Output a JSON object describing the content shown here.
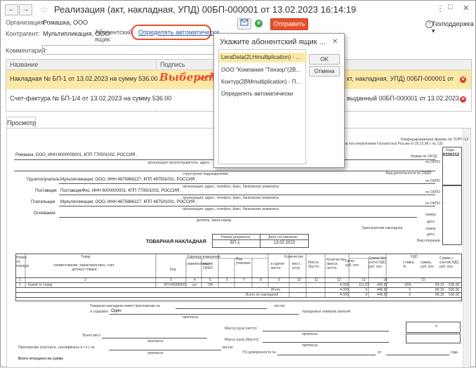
{
  "window": {
    "title": "Реализация (акт, накладная, УПД) 00БП-000001 от 13.02.2023 16:14:19",
    "nav_back": "←",
    "nav_forward": "→",
    "star": "☆",
    "more": "⋮",
    "restore": "□",
    "close": "✕"
  },
  "form": {
    "org_label": "Организация:",
    "org_value": "Ромашка, ООО",
    "contr_label": "Контрагент:",
    "contr_value": "Мультипликация, ООО",
    "abon_label_1": "Абонентский",
    "abon_label_2": "ящик:",
    "abon_link": "Определять автоматически",
    "comment_label": "Комментарий:",
    "send_button": "Отправить",
    "support_label": "Техподдержка",
    "support_arrow": "▾",
    "help": "?"
  },
  "table": {
    "col_name": "Название",
    "col_sign": "Подпись",
    "rows": [
      {
        "name": "Накладная № БП-1 от 13.02.2023 на сумму 536.00",
        "right": "кт, накладная, УПД) 00БП-000001 от"
      },
      {
        "name": "Счет-фактура № БП-1/4 от 13.02.2023 на сумму 536.00",
        "right": "выданный 00БП-000001 от 13.02.2023"
      }
    ],
    "annotation": "Выберите"
  },
  "tab": {
    "label": "Просмотр"
  },
  "popup": {
    "title": "Укажите абонентский ящик ...",
    "close": "✕",
    "items": [
      "LeraData(2LHmultiplication) - ...",
      "ООО \"Компания \"Тензор\"(2B...",
      "Контур(2BMmultiplication) - П...",
      "Определять автоматически"
    ],
    "ok": "OK",
    "cancel": "Отмена"
  },
  "doc": {
    "header_form": "Унифицированная форма № ТОРГ-12",
    "header_decree": "...дена постановлением Госкомстата России от 25.12.98 г. № 132",
    "codes": "Коды",
    "okud_label": "Форма по ОКУД",
    "okud": "0330212",
    "okpo": "по ОКПО",
    "supplier_org": "Ромашка, ООО, ИНН 6000000001, КПП 770501002, РОССИЯ ,",
    "org_caption": "организация-грузоотправитель, адрес,",
    "unit_caption": "структурное подразделение",
    "okdp": "Вид деятельности по ОКДП",
    "consignee_label": "Грузополучатель",
    "consignee": "Мультипликация, ООО, ИНН 4875866227, КПП 487501001, РОССИЯ ,",
    "contacts_caption": "организация, адрес, телефон, факс, банковские реквизиты",
    "supplier_label": "Поставщик",
    "supplier": "ПоставщикФнс, ИНН 6000000001, КПП 770501002, РОССИЯ ,",
    "payer_label": "Плательщик",
    "payer": "Мультипликация, ООО, ИНН 4875866227, КПП 487501001, РОССИЯ ,",
    "basis_label": "Основание",
    "contract_caption": "договор, заказ-наряд",
    "nomer": "номер",
    "data": "дата",
    "transport": "Транспортная накладная",
    "op_type": "Вид операции",
    "doc_num_label": "Номер документа",
    "doc_date_label": "Дата составления",
    "doc_num": "БП-1",
    "doc_date": "13.02.2023",
    "waybill_title": "ТОВАРНАЯ НАКЛАДНАЯ",
    "cols": {
      "num": "Номер по порядку",
      "goods": "Товар",
      "name_desc": "наименование, характеристика, сорт, артикул товара",
      "code": "Код",
      "unit": "Единица измерения",
      "unit_name": "наименование",
      "okei": "код по ОКЕИ",
      "pack": "Вид упаковки",
      "qty": "Количество",
      "in_one": "в одном месте",
      "places": "мест, штук",
      "gross": "Масса брутто",
      "qty_net": "Количество (масса нетто)",
      "price": "Цена, руб. коп.",
      "sum_no_vat": "Сумма без учета НДС, руб. коп.",
      "vat": "НДС",
      "rate": "ставка, %",
      "vat_sum": "сумма, руб. коп.",
      "sum_with_vat": "Сумма с учетом НДС, руб. коп."
    },
    "col_nums": [
      "1",
      "2",
      "3",
      "4",
      "5",
      "6",
      "7",
      "8",
      "9",
      "10",
      "11",
      "12",
      "13",
      "14",
      "15"
    ],
    "item": {
      "n": "1",
      "name": "Какой то товар",
      "code": "БП-00000001",
      "unit": "шт",
      "okei": "796",
      "qty": "4.000",
      "price": "111.67",
      "sum": "446.67",
      "rate": "20%",
      "vat": "89.33",
      "total": "536.00"
    },
    "itogo_label": "Итого",
    "itogo": {
      "qty": "4.000",
      "x1": "X",
      "sum": "446.67",
      "x2": "X",
      "vat": "89.33",
      "total": "536.00"
    },
    "vsego_label": "Всего по накладной",
    "vsego": {
      "qty": "4.000",
      "x1": "X",
      "sum": "446.67",
      "x2": "X",
      "vat": "89.33",
      "total": "536.00"
    },
    "appendix": "Товарная накладная имеет приложение на",
    "sheets": "листах",
    "contains": "и содержит",
    "contains_val": "Один",
    "records": "порядковых номеров записей",
    "propisyu": "прописью",
    "net_mass": "Масса груза (нетто)",
    "gross_mass": "Масса груза (брутто)",
    "four": "4",
    "total_places": "Всего мест",
    "attachment": "Приложение (паспорта, сертификаты и т.п.) на",
    "sheets2": "листах",
    "power": "По доверенности №",
    "ot": "от",
    "god": "года",
    "vsego_otp": "Всего отпущено на сумму"
  }
}
